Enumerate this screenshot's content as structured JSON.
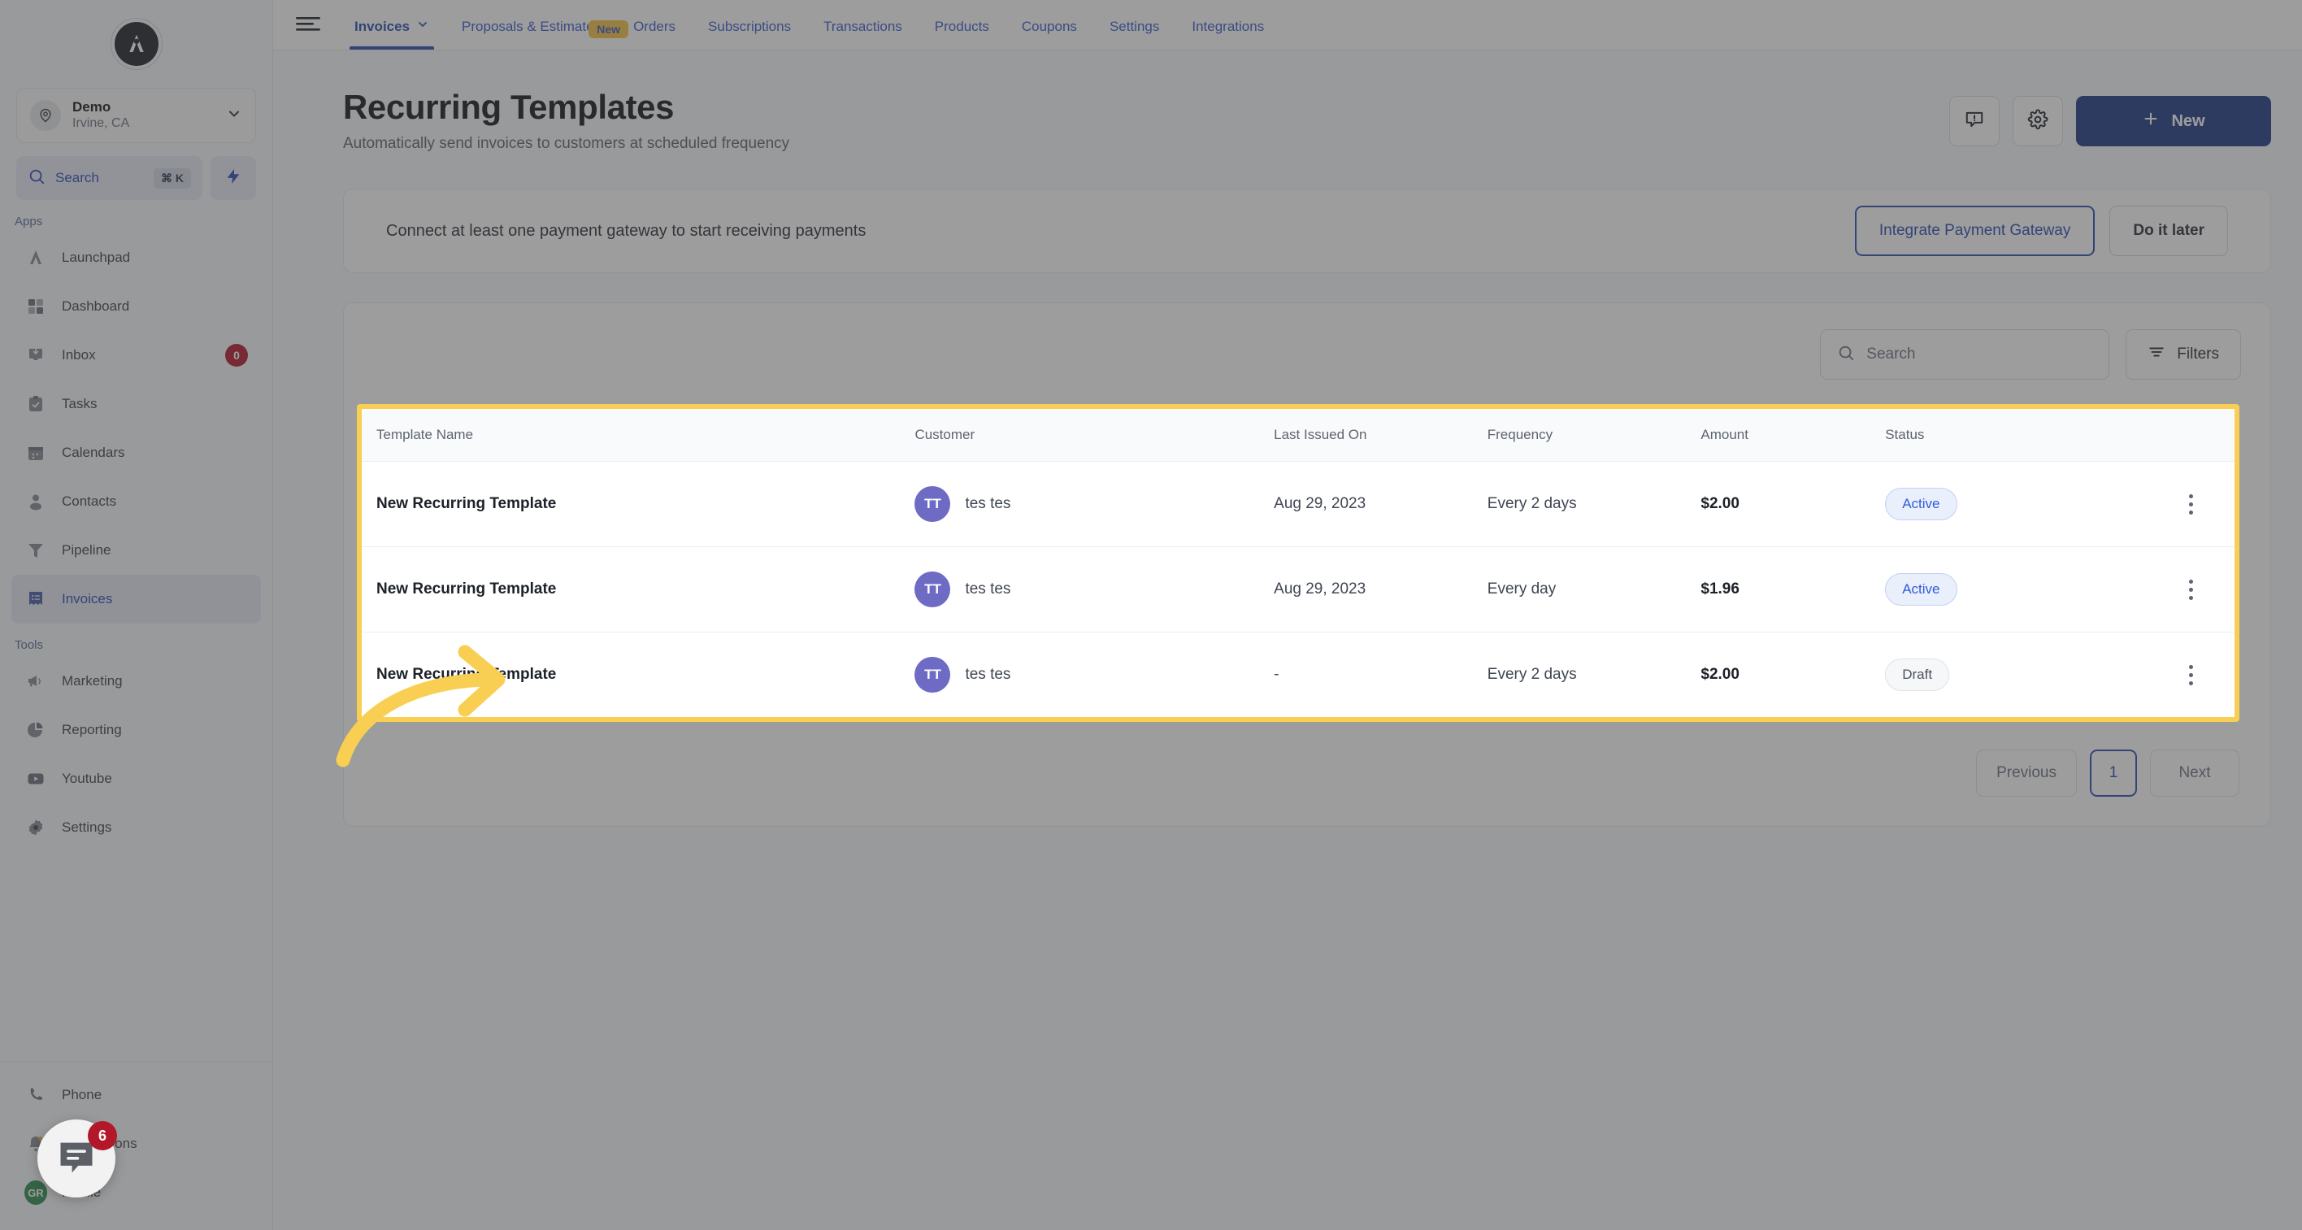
{
  "sidebar": {
    "logo_letter": "A",
    "location": {
      "name": "Demo",
      "sublabel": "Irvine, CA",
      "icon": "location-pin-icon",
      "chevron": "chevron-down-icon"
    },
    "search": {
      "label": "Search",
      "shortcut": "⌘ K",
      "icon": "search-icon"
    },
    "quick_action_icon": "bolt-icon",
    "sections": [
      {
        "label": "Apps",
        "items": [
          {
            "label": "Launchpad",
            "icon": "rocket-icon",
            "badge": null,
            "active": false
          },
          {
            "label": "Dashboard",
            "icon": "grid-icon",
            "badge": null,
            "active": false
          },
          {
            "label": "Inbox",
            "icon": "inbox-icon",
            "badge": "0",
            "active": false
          },
          {
            "label": "Tasks",
            "icon": "clipboard-check-icon",
            "badge": null,
            "active": false
          },
          {
            "label": "Calendars",
            "icon": "calendar-icon",
            "badge": null,
            "active": false
          },
          {
            "label": "Contacts",
            "icon": "person-icon",
            "badge": null,
            "active": false
          },
          {
            "label": "Pipeline",
            "icon": "funnel-icon",
            "badge": null,
            "active": false
          },
          {
            "label": "Invoices",
            "icon": "invoice-icon",
            "badge": null,
            "active": true
          }
        ]
      },
      {
        "label": "Tools",
        "items": [
          {
            "label": "Marketing",
            "icon": "megaphone-icon",
            "badge": null,
            "active": false
          },
          {
            "label": "Reporting",
            "icon": "pie-chart-icon",
            "badge": null,
            "active": false
          },
          {
            "label": "Youtube",
            "icon": "youtube-icon",
            "badge": null,
            "active": false
          },
          {
            "label": "Settings",
            "icon": "gear-icon",
            "badge": null,
            "active": false
          }
        ]
      }
    ],
    "bottom_items": [
      {
        "label": "Phone",
        "icon": "phone-icon",
        "badge": null
      },
      {
        "label": "Notifications",
        "icon": "bell-icon",
        "badge": null
      },
      {
        "label": "Profile",
        "icon": "avatar-initials",
        "avatar_initials": "GR",
        "badge": null
      }
    ],
    "chat_widget": {
      "icon": "chat-bubble-icon",
      "badge": "6"
    }
  },
  "topbar": {
    "menu_icon": "hamburger-icon",
    "tabs": [
      {
        "label": "Invoices",
        "active": true,
        "chevron": "chevron-down-icon",
        "badge": null
      },
      {
        "label": "Proposals & Estimates",
        "active": false,
        "chevron": null,
        "badge": "New"
      },
      {
        "label": "Orders",
        "active": false,
        "chevron": null,
        "badge": null
      },
      {
        "label": "Subscriptions",
        "active": false,
        "chevron": null,
        "badge": null
      },
      {
        "label": "Transactions",
        "active": false,
        "chevron": null,
        "badge": null
      },
      {
        "label": "Products",
        "active": false,
        "chevron": null,
        "badge": null
      },
      {
        "label": "Coupons",
        "active": false,
        "chevron": null,
        "badge": null
      },
      {
        "label": "Settings",
        "active": false,
        "chevron": null,
        "badge": null
      },
      {
        "label": "Integrations",
        "active": false,
        "chevron": null,
        "badge": null
      }
    ]
  },
  "page": {
    "title": "Recurring Templates",
    "subtitle": "Automatically send invoices to customers at scheduled frequency",
    "actions": {
      "feedback_icon": "feedback-bubble-icon",
      "settings_icon": "gear-icon",
      "new_button": {
        "label": "New",
        "icon": "plus-icon"
      }
    }
  },
  "banner": {
    "message": "Connect at least one payment gateway to start receiving payments",
    "primary_action": "Integrate Payment Gateway",
    "secondary_action": "Do it later"
  },
  "toolbar": {
    "search_placeholder": "Search",
    "search_value": "",
    "search_icon": "search-icon",
    "filters_label": "Filters",
    "filters_icon": "filter-icon"
  },
  "table": {
    "columns": [
      "Template Name",
      "Customer",
      "Last Issued On",
      "Frequency",
      "Amount",
      "Status"
    ],
    "rows": [
      {
        "name": "New Recurring Template",
        "customer": "tes tes",
        "customer_initials": "TT",
        "last_issued_on": "Aug 29, 2023",
        "frequency": "Every 2 days",
        "amount": "$2.00",
        "status": "Active",
        "status_type": "active",
        "menu_icon": "kebab-menu-icon"
      },
      {
        "name": "New Recurring Template",
        "customer": "tes tes",
        "customer_initials": "TT",
        "last_issued_on": "Aug 29, 2023",
        "frequency": "Every day",
        "amount": "$1.96",
        "status": "Active",
        "status_type": "active",
        "menu_icon": "kebab-menu-icon"
      },
      {
        "name": "New Recurring Template",
        "customer": "tes tes",
        "customer_initials": "TT",
        "last_issued_on": "-",
        "frequency": "Every 2 days",
        "amount": "$2.00",
        "status": "Draft",
        "status_type": "draft",
        "menu_icon": "kebab-menu-icon"
      }
    ]
  },
  "pagination": {
    "previous": "Previous",
    "current_page": "1",
    "next": "Next"
  },
  "annotation": {
    "arrow": "curved-arrow-right",
    "highlight_color": "#f8cf52"
  },
  "colors": {
    "accent_blue": "#2b4cb3",
    "primary_button": "#213a87",
    "highlight_yellow": "#f8cf52",
    "badge_red": "#b3182a",
    "avatar_purple": "#6e6bc4"
  }
}
